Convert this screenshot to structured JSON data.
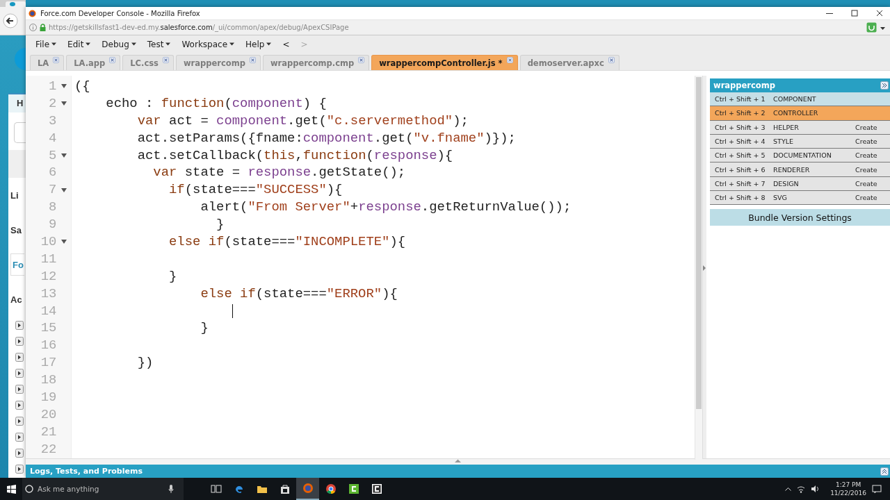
{
  "background_window": {
    "labels": [
      {
        "text": "H",
        "kind": "tab"
      },
      {
        "text": "Li",
        "kind": "heading"
      },
      {
        "text": "Sa",
        "kind": "heading"
      },
      {
        "text": "Fo",
        "kind": "link"
      },
      {
        "text": "Ac",
        "kind": "heading"
      }
    ]
  },
  "window": {
    "title": "Force.com Developer Console - Mozilla Firefox"
  },
  "address_bar": {
    "url_prefix": "https://getskillsfast1-dev-ed.my.",
    "url_domain": "salesforce.com",
    "url_path": "/_ui/common/apex/debug/ApexCSIPage"
  },
  "menu": {
    "items": [
      {
        "label": "File",
        "kind": "menu",
        "disabled": false
      },
      {
        "label": "Edit",
        "kind": "menu",
        "disabled": false
      },
      {
        "label": "Debug",
        "kind": "menu",
        "disabled": false
      },
      {
        "label": "Test",
        "kind": "menu",
        "disabled": false
      },
      {
        "label": "Workspace",
        "kind": "menu",
        "disabled": false
      },
      {
        "label": "Help",
        "kind": "menu",
        "disabled": false
      },
      {
        "label": "<",
        "kind": "nav",
        "disabled": false
      },
      {
        "label": ">",
        "kind": "nav",
        "disabled": true
      }
    ]
  },
  "tabs": [
    {
      "label": "LA",
      "selected": false
    },
    {
      "label": "LA.app",
      "selected": false
    },
    {
      "label": "LC.css",
      "selected": false
    },
    {
      "label": "wrappercomp",
      "selected": false
    },
    {
      "label": "wrappercomp.cmp",
      "selected": false
    },
    {
      "label": "wrappercompController.js *",
      "selected": true
    },
    {
      "label": "demoserver.apxc",
      "selected": false
    }
  ],
  "editor": {
    "lines": [
      {
        "number": "1",
        "foldable": true,
        "cursor": false,
        "tokens": [
          {
            "kind": "plain",
            "text": "({"
          }
        ]
      },
      {
        "number": "2",
        "foldable": true,
        "cursor": false,
        "tokens": [
          {
            "kind": "plain",
            "text": "    echo : "
          },
          {
            "kind": "keyword",
            "text": "function"
          },
          {
            "kind": "plain",
            "text": "("
          },
          {
            "kind": "variable",
            "text": "component"
          },
          {
            "kind": "plain",
            "text": ") {"
          }
        ]
      },
      {
        "number": "3",
        "foldable": false,
        "cursor": false,
        "tokens": [
          {
            "kind": "keyword",
            "text": "        var"
          },
          {
            "kind": "plain",
            "text": " act = "
          },
          {
            "kind": "variable",
            "text": "component"
          },
          {
            "kind": "plain",
            "text": ".get("
          },
          {
            "kind": "string",
            "text": "\"c.servermethod\""
          },
          {
            "kind": "plain",
            "text": ");"
          }
        ]
      },
      {
        "number": "4",
        "foldable": false,
        "cursor": false,
        "tokens": [
          {
            "kind": "plain",
            "text": "        act.setParams({fname:"
          },
          {
            "kind": "variable",
            "text": "component"
          },
          {
            "kind": "plain",
            "text": ".get("
          },
          {
            "kind": "string",
            "text": "\"v.fname\""
          },
          {
            "kind": "plain",
            "text": ")});"
          }
        ]
      },
      {
        "number": "5",
        "foldable": true,
        "cursor": false,
        "tokens": [
          {
            "kind": "plain",
            "text": "        act.setCallback("
          },
          {
            "kind": "keyword",
            "text": "this"
          },
          {
            "kind": "plain",
            "text": ","
          },
          {
            "kind": "keyword",
            "text": "function"
          },
          {
            "kind": "plain",
            "text": "("
          },
          {
            "kind": "variable",
            "text": "response"
          },
          {
            "kind": "plain",
            "text": "){"
          }
        ]
      },
      {
        "number": "6",
        "foldable": false,
        "cursor": false,
        "tokens": [
          {
            "kind": "keyword",
            "text": "          var"
          },
          {
            "kind": "plain",
            "text": " state = "
          },
          {
            "kind": "variable",
            "text": "response"
          },
          {
            "kind": "plain",
            "text": ".getState();"
          }
        ]
      },
      {
        "number": "7",
        "foldable": true,
        "cursor": false,
        "tokens": [
          {
            "kind": "keyword",
            "text": "            if"
          },
          {
            "kind": "plain",
            "text": "(state==="
          },
          {
            "kind": "string",
            "text": "\"SUCCESS\""
          },
          {
            "kind": "plain",
            "text": "){"
          }
        ]
      },
      {
        "number": "8",
        "foldable": false,
        "cursor": false,
        "tokens": [
          {
            "kind": "plain",
            "text": "                alert("
          },
          {
            "kind": "string",
            "text": "\"From Server\""
          },
          {
            "kind": "plain",
            "text": "+"
          },
          {
            "kind": "variable",
            "text": "response"
          },
          {
            "kind": "plain",
            "text": ".getReturnValue());"
          }
        ]
      },
      {
        "number": "9",
        "foldable": false,
        "cursor": false,
        "tokens": [
          {
            "kind": "plain",
            "text": "                  }"
          }
        ]
      },
      {
        "number": "10",
        "foldable": true,
        "cursor": false,
        "tokens": [
          {
            "kind": "keyword",
            "text": "            else if"
          },
          {
            "kind": "plain",
            "text": "(state==="
          },
          {
            "kind": "string",
            "text": "\"INCOMPLETE\""
          },
          {
            "kind": "plain",
            "text": "){"
          }
        ]
      },
      {
        "number": "11",
        "foldable": false,
        "cursor": false
      },
      {
        "number": "12",
        "foldable": false,
        "cursor": false,
        "tokens": [
          {
            "kind": "plain",
            "text": "            }"
          }
        ]
      },
      {
        "number": "13",
        "foldable": false,
        "cursor": false,
        "tokens": [
          {
            "kind": "keyword",
            "text": "                else if"
          },
          {
            "kind": "plain",
            "text": "(state==="
          },
          {
            "kind": "string",
            "text": "\"ERROR\""
          },
          {
            "kind": "plain",
            "text": "){"
          }
        ]
      },
      {
        "number": "14",
        "foldable": false,
        "cursor": true
      },
      {
        "number": "15",
        "foldable": false,
        "cursor": false,
        "tokens": [
          {
            "kind": "plain",
            "text": "                }"
          }
        ]
      },
      {
        "number": "16",
        "foldable": false,
        "cursor": false
      },
      {
        "number": "17",
        "foldable": false,
        "cursor": false,
        "tokens": [
          {
            "kind": "plain",
            "text": "        })"
          }
        ]
      },
      {
        "number": "18",
        "foldable": false,
        "cursor": false
      },
      {
        "number": "19",
        "foldable": false,
        "cursor": false
      },
      {
        "number": "20",
        "foldable": false,
        "cursor": false
      },
      {
        "number": "21",
        "foldable": false,
        "cursor": false
      },
      {
        "number": "22",
        "foldable": false,
        "cursor": false
      }
    ]
  },
  "bundle": {
    "title": "wrappercomp",
    "rows": [
      {
        "shortcut": "Ctrl + Shift + 1",
        "name": "COMPONENT",
        "defined": true,
        "selected": false
      },
      {
        "shortcut": "Ctrl + Shift + 2",
        "name": "CONTROLLER",
        "defined": true,
        "selected": true
      },
      {
        "shortcut": "Ctrl + Shift + 3",
        "name": "HELPER",
        "action": "Create",
        "defined": false,
        "selected": false
      },
      {
        "shortcut": "Ctrl + Shift + 4",
        "name": "STYLE",
        "action": "Create",
        "defined": false,
        "selected": false
      },
      {
        "shortcut": "Ctrl + Shift + 5",
        "name": "DOCUMENTATION",
        "action": "Create",
        "defined": false,
        "selected": false
      },
      {
        "shortcut": "Ctrl + Shift + 6",
        "name": "RENDERER",
        "action": "Create",
        "defined": false,
        "selected": false
      },
      {
        "shortcut": "Ctrl + Shift + 7",
        "name": "DESIGN",
        "action": "Create",
        "defined": false,
        "selected": false
      },
      {
        "shortcut": "Ctrl + Shift + 8",
        "name": "SVG",
        "action": "Create",
        "defined": false,
        "selected": false
      }
    ],
    "settings_button": "Bundle Version Settings"
  },
  "logs_bar": {
    "title": "Logs, Tests, and Problems"
  },
  "taskbar": {
    "search_placeholder": "Ask me anything",
    "apps": [
      {
        "active": false
      },
      {
        "active": false
      },
      {
        "active": false
      },
      {
        "active": false
      },
      {
        "active": true
      },
      {
        "active": false
      },
      {
        "active": false
      },
      {
        "active": false
      }
    ],
    "time": "1:27 PM",
    "date": "11/22/2016"
  }
}
